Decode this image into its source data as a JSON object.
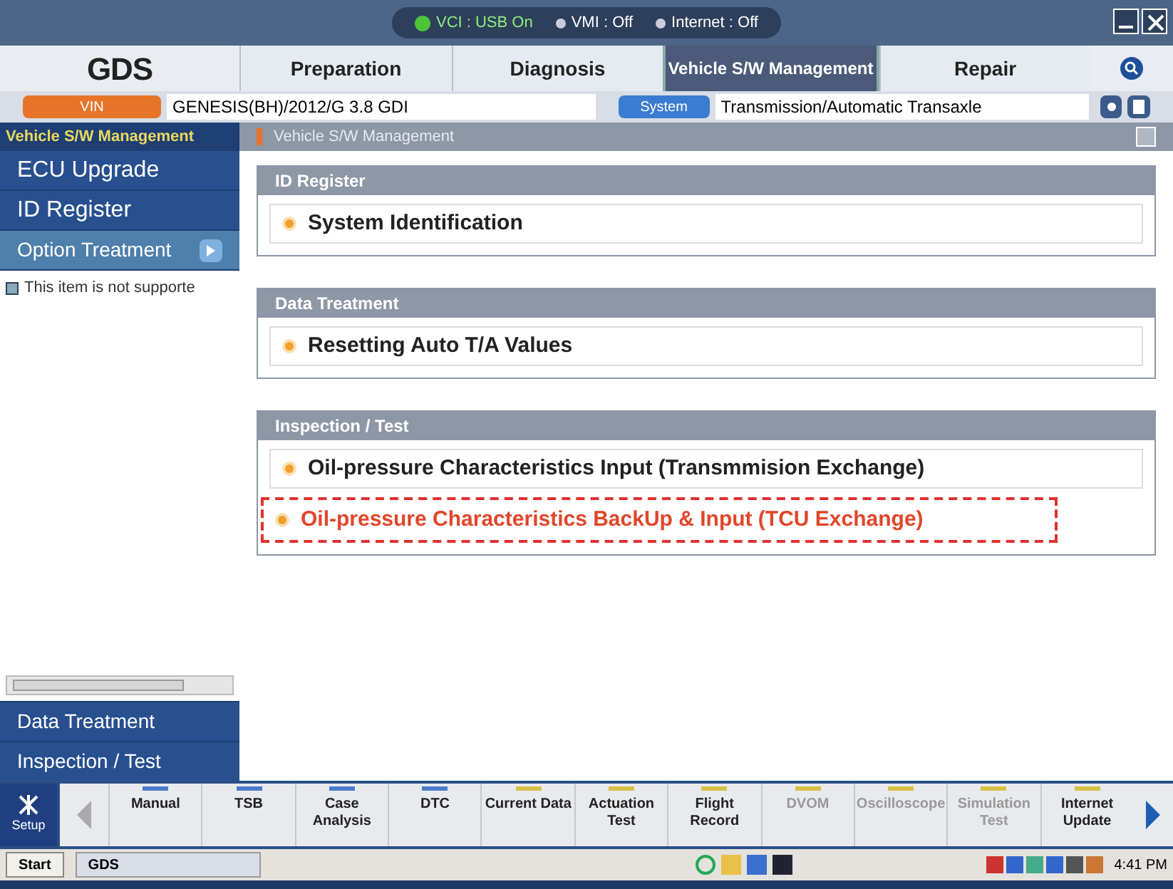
{
  "status": [
    {
      "label": "VCI : USB On",
      "on": true
    },
    {
      "label": "VMI : Off",
      "on": false
    },
    {
      "label": "Internet : Off",
      "on": false
    }
  ],
  "logo": "GDS",
  "tabs": [
    {
      "label": "Preparation",
      "selected": false
    },
    {
      "label": "Diagnosis",
      "selected": false
    },
    {
      "label": "Vehicle S/W Management",
      "selected": true
    },
    {
      "label": "Repair",
      "selected": false
    }
  ],
  "vin": {
    "button": "VIN",
    "value": "GENESIS(BH)/2012/G 3.8 GDI"
  },
  "system": {
    "button": "System",
    "value": "Transmission/Automatic Transaxle"
  },
  "sidebar": {
    "title": "Vehicle S/W Management",
    "items": [
      {
        "label": "ECU Upgrade",
        "selected": false
      },
      {
        "label": "ID Register",
        "selected": false
      },
      {
        "label": "Option Treatment",
        "selected": true
      }
    ],
    "note": "This item is not supporte",
    "bottom_items": [
      "Data Treatment",
      "Inspection / Test"
    ]
  },
  "breadcrumb": "Vehicle S/W Management",
  "sections": [
    {
      "title": "ID Register",
      "items": [
        {
          "label": "System Identification",
          "highlighted": false
        }
      ]
    },
    {
      "title": "Data Treatment",
      "items": [
        {
          "label": "Resetting Auto T/A Values",
          "highlighted": false
        }
      ]
    },
    {
      "title": "Inspection / Test",
      "items": [
        {
          "label": "Oil-pressure Characteristics Input (Transmmision Exchange)",
          "highlighted": false
        },
        {
          "label": "Oil-pressure Characteristics BackUp & Input (TCU Exchange)",
          "highlighted": true
        }
      ]
    }
  ],
  "setup": "Setup",
  "toolbar": [
    {
      "label": "Manual",
      "color": "#4a7cc8",
      "disabled": false
    },
    {
      "label": "TSB",
      "color": "#4a7cc8",
      "disabled": false
    },
    {
      "label": "Case Analysis",
      "color": "#4a7cc8",
      "disabled": false
    },
    {
      "label": "DTC",
      "color": "#4a7cc8",
      "disabled": false
    },
    {
      "label": "Current Data",
      "color": "#d8c048",
      "disabled": false
    },
    {
      "label": "Actuation Test",
      "color": "#d8c048",
      "disabled": false
    },
    {
      "label": "Flight Record",
      "color": "#d8c048",
      "disabled": false
    },
    {
      "label": "DVOM",
      "color": "#d8c048",
      "disabled": true
    },
    {
      "label": "Oscilloscope",
      "color": "#d8c048",
      "disabled": true
    },
    {
      "label": "Simulation Test",
      "color": "#d8c048",
      "disabled": true
    },
    {
      "label": "Internet Update",
      "color": "#d8c048",
      "disabled": false
    }
  ],
  "taskbar": {
    "start": "Start",
    "task": "GDS",
    "clock": "4:41 PM"
  }
}
